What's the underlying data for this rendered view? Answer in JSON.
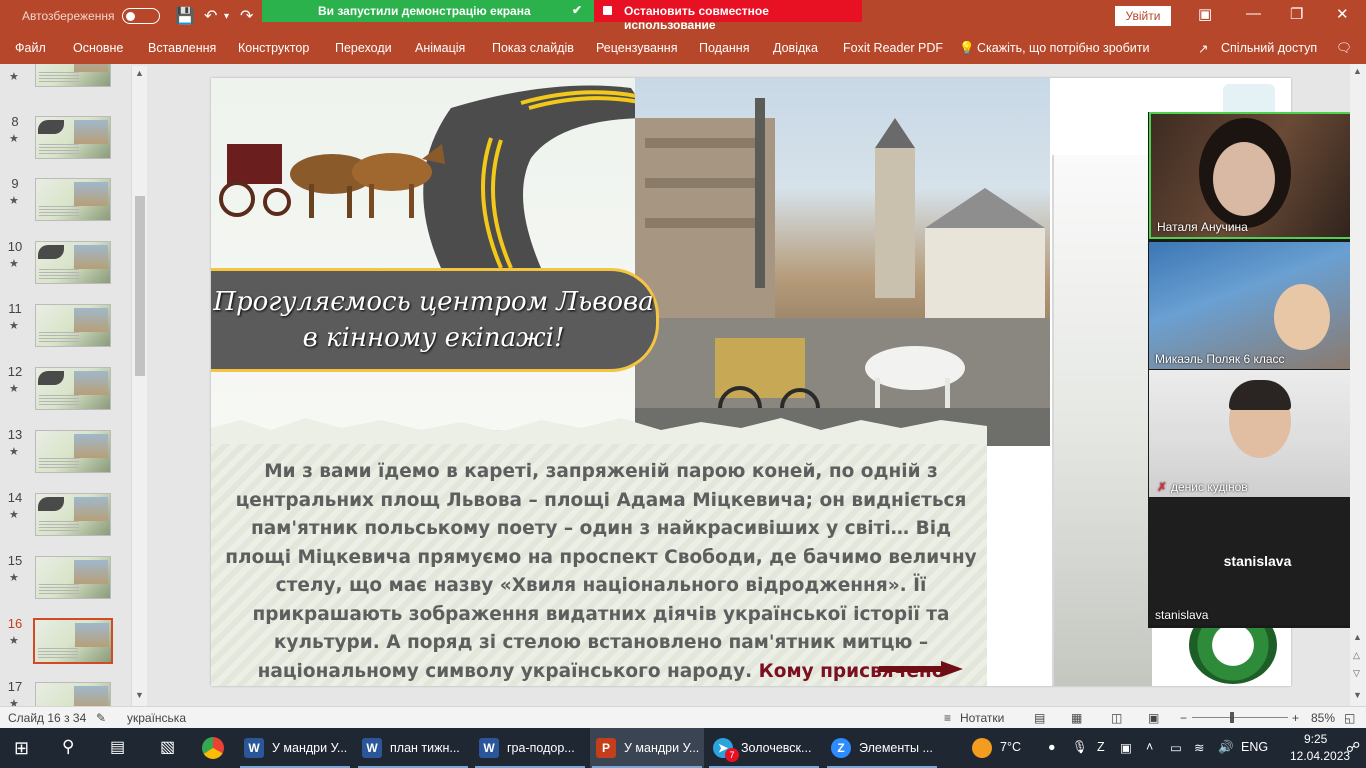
{
  "titlebar": {
    "autosave_label": "Автозбереження",
    "share_notice": "Ви запустили демонстрацію екрана",
    "stop_share": "Остановить совместное использование",
    "signin": "Увійти"
  },
  "ribbon_tabs": [
    "Файл",
    "Основне",
    "Вставлення",
    "Конструктор",
    "Переходи",
    "Анімація",
    "Показ слайдів",
    "Рецензування",
    "Подання",
    "Довідка",
    "Foxit Reader PDF",
    "Скажіть, що потрібно зробити",
    "Спільний доступ"
  ],
  "thumbnails": {
    "numbers": [
      "8",
      "9",
      "10",
      "11",
      "12",
      "13",
      "14",
      "15",
      "16",
      "17"
    ],
    "selected": "16"
  },
  "slide": {
    "title_line1": "Прогуляємось центром Львова",
    "title_line2": "в кінному екіпажі!",
    "body": "Ми з вами їдемо в кареті, запряженій парою коней, по одній з центральних площ Львова – площі Адама Міцкевича; он видніється пам'ятник польському поету – один з найкрасивіших у світі… Від площі Міцкевича прямуємо на проспект Свободи, де бачимо величну стелу, що має назву «Хвиля національного відродження». Її прикрашають зображення видатних діячів української історії та культури. А поряд зі стелою встановлено пам'ятник митцю – національному символу українського народу.",
    "question": "Кому присвячено пам'ятник?"
  },
  "video": {
    "participants": [
      "Наталя Анучина",
      "Микаэль Поляк 6 класс",
      "денис кудінов",
      "stanislava"
    ],
    "big_name": "stanislava"
  },
  "statusbar": {
    "slide_info": "Слайд 16 з 34",
    "language": "українська",
    "notes": "Нотатки",
    "zoom": "85%"
  },
  "taskbar": {
    "apps": [
      "У мандри У...",
      "план тижн...",
      "гра-подор...",
      "У мандри У...",
      "Золочевск...",
      "Элементы ..."
    ],
    "weather": "7°C",
    "lang": "ENG",
    "time": "9:25",
    "date": "12.04.2023",
    "telegram_badge": "7"
  },
  "colors": {
    "accent": "#b7472a",
    "share_green": "#2bb24c",
    "share_red": "#e81123",
    "speaker_border": "#4fd150"
  }
}
